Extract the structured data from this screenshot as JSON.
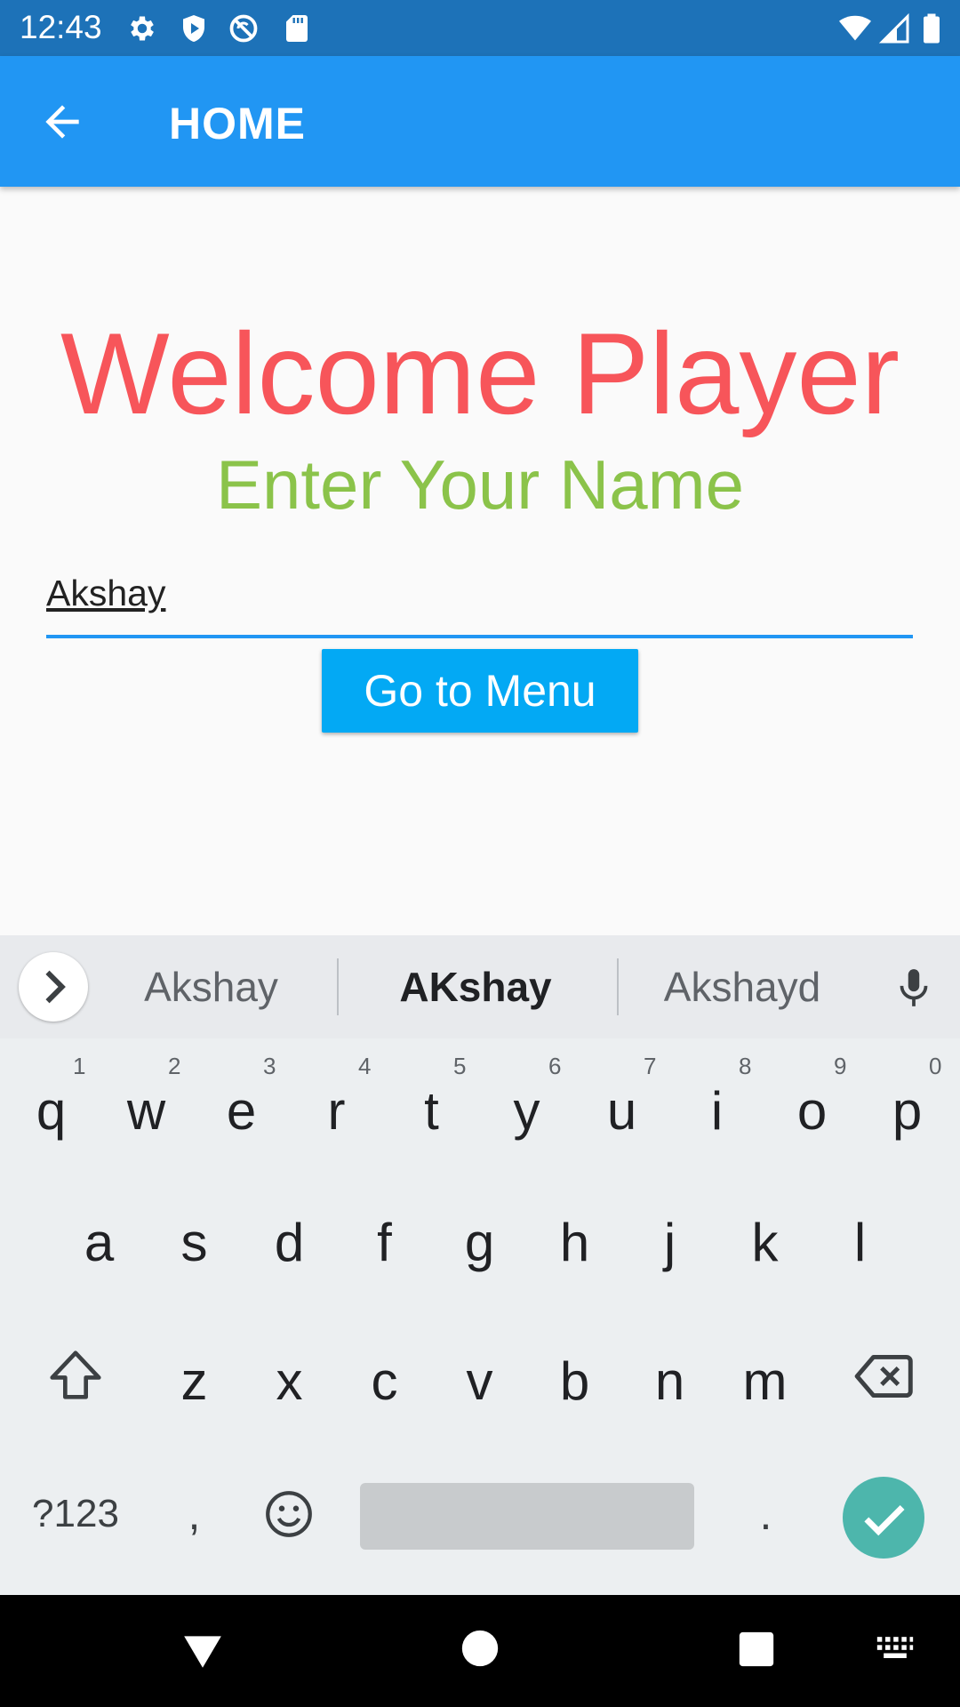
{
  "status_bar": {
    "time": "12:43",
    "left_icons": [
      "gear-icon",
      "shield-icon",
      "no-sync-icon",
      "sd-card-icon"
    ],
    "right_icons": [
      "wifi-icon",
      "signal-icon",
      "battery-icon"
    ]
  },
  "app_bar": {
    "title": "HOME",
    "back_icon": "arrow-back-icon",
    "color": "#2196f3"
  },
  "content": {
    "heading": "Welcome Player",
    "subheading": "Enter Your Name",
    "name_value": "Akshay",
    "button_label": "Go to Menu",
    "heading_color": "#f7555a",
    "subheading_color": "#8bc34a",
    "button_color": "#03a9f4"
  },
  "keyboard": {
    "suggestions": [
      "Akshay",
      "AKshay",
      "Akshayd"
    ],
    "row1": [
      "q",
      "w",
      "e",
      "r",
      "t",
      "y",
      "u",
      "i",
      "o",
      "p"
    ],
    "row1_numbers": [
      "1",
      "2",
      "3",
      "4",
      "5",
      "6",
      "7",
      "8",
      "9",
      "0"
    ],
    "row2": [
      "a",
      "s",
      "d",
      "f",
      "g",
      "h",
      "j",
      "k",
      "l"
    ],
    "row3": [
      "z",
      "x",
      "c",
      "v",
      "b",
      "n",
      "m"
    ],
    "symbols_label": "?123",
    "comma": ",",
    "period": ".",
    "enter_color": "#4db6ac"
  },
  "nav_bar": {
    "icons": [
      "back-triangle-icon",
      "home-circle-icon",
      "recents-square-icon",
      "keyboard-icon"
    ]
  }
}
